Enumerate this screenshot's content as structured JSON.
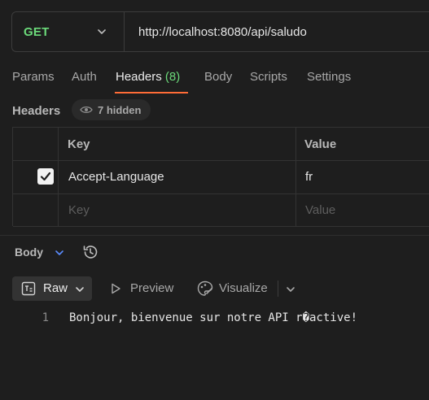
{
  "request": {
    "method": "GET",
    "url": "http://localhost:8080/api/saludo"
  },
  "tabs": [
    {
      "label": "Params"
    },
    {
      "label": "Auth"
    },
    {
      "label": "Headers",
      "count": "(8)"
    },
    {
      "label": "Body"
    },
    {
      "label": "Scripts"
    },
    {
      "label": "Settings"
    }
  ],
  "headers_section": {
    "label": "Headers",
    "hidden_badge": "7 hidden",
    "columns": {
      "key": "Key",
      "value": "Value"
    },
    "rows": [
      {
        "key": "Accept-Language",
        "value": "fr",
        "checked": true
      }
    ],
    "placeholder": {
      "key": "Key",
      "value": "Value"
    }
  },
  "response": {
    "section_label": "Body",
    "format": "Raw",
    "preview_label": "Preview",
    "visualize_label": "Visualize",
    "lines": [
      {
        "number": "1",
        "text": "Bonjour, bienvenue sur notre API r�active!"
      }
    ]
  },
  "colors": {
    "method": "#6bd97a",
    "accent_underline": "#ff6c37",
    "background": "#1e1e1e"
  },
  "icons": [
    "chevron-down-icon",
    "eye-icon",
    "check-icon",
    "history-icon",
    "raw-text-icon",
    "play-icon",
    "visualize-icon"
  ]
}
